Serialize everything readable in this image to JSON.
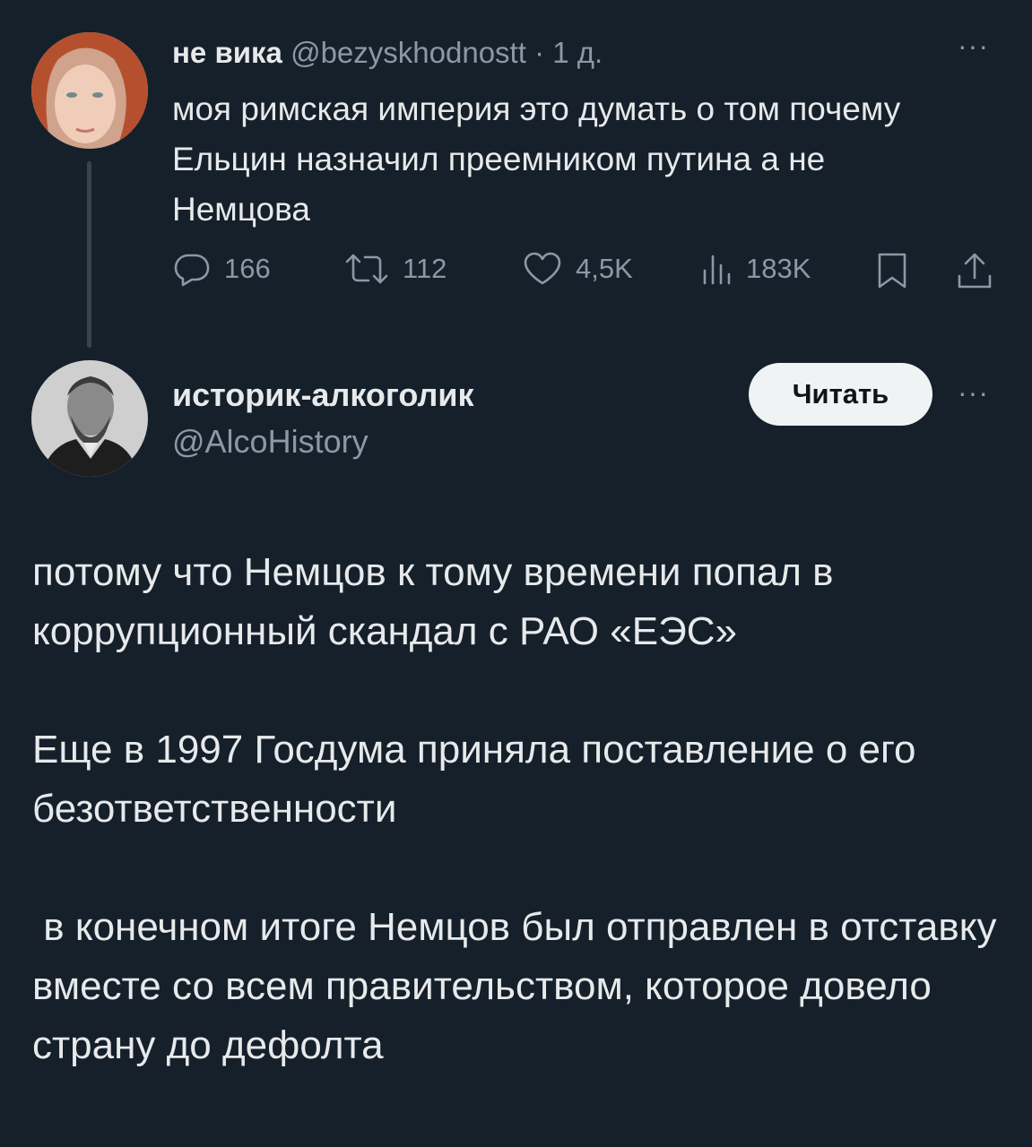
{
  "tweet1": {
    "author_name": "не вика",
    "author_handle": "@bezyskhodnostt",
    "separator": "·",
    "time": "1 д.",
    "more": "···",
    "text": "моя римская империя это думать о том почему Ельцин назначил преемником путина а не Немцова",
    "actions": {
      "replies": "166",
      "reposts": "112",
      "likes": "4,5K",
      "views": "183K"
    },
    "icons": [
      "reply-icon",
      "repost-icon",
      "like-icon",
      "views-icon",
      "bookmark-icon",
      "share-icon"
    ]
  },
  "tweet2": {
    "author_name": "историк-алкоголик",
    "author_handle": "@AlcoHistory",
    "follow_label": "Читать",
    "more": "···",
    "paragraphs": [
      "потому что Немцов к тому времени попал в коррупционный скандал с РАО «ЕЭС»",
      "Еще в 1997 Госдума приняла поставление о его безответственности",
      " в конечном итоге Немцов был отправлен в отставку вместе со всем правительством, которое довело страну до дефолта"
    ]
  },
  "colors": {
    "background": "#15202b",
    "text": "#e7e9ea",
    "muted": "#8b98a5",
    "thread_line": "#38444d",
    "button_bg": "#eff3f4",
    "button_text": "#0f1419"
  }
}
